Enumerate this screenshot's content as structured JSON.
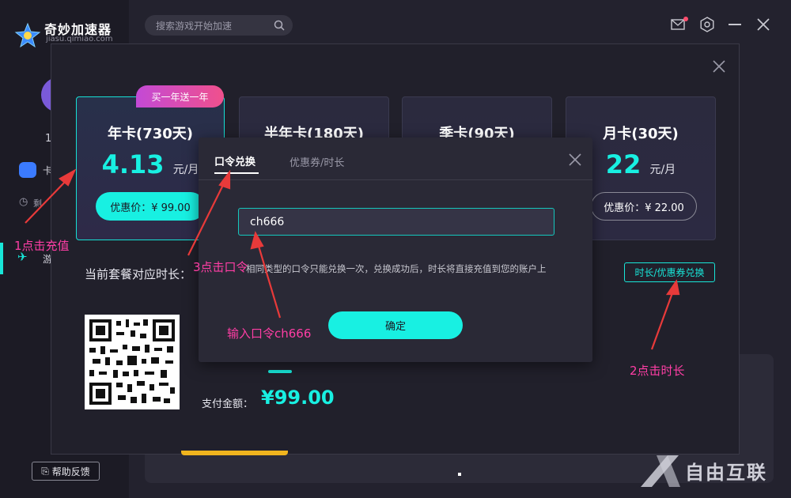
{
  "app": {
    "name": "奇妙加速器",
    "domain": "jiasu.qimiao.com"
  },
  "sidebar": {
    "user_fragment": "1",
    "card_fragment": "卡",
    "time_fragment": "剩",
    "game_fragment": "游",
    "help_label": "帮助反馈"
  },
  "topbar": {
    "search_placeholder": "搜索游戏开始加速"
  },
  "plans": [
    {
      "name": "年卡(730天)",
      "price": "4.13",
      "unit": "元/月",
      "button": "优惠价：¥ 99.00",
      "badge": "买一年送一年",
      "selected": true
    },
    {
      "name": "半年卡(180天)",
      "selected": false
    },
    {
      "name": "季卡(90天)",
      "selected": false
    },
    {
      "name": "月卡(30天)",
      "price": "22",
      "unit": "元/月",
      "button": "优惠价：¥ 22.00",
      "selected": false
    }
  ],
  "payment": {
    "duration_label": "当前套餐对应时长：",
    "redeem_button": "时长/优惠券兑换",
    "amount_label": "支付金额：",
    "amount": "¥99.00"
  },
  "code_dialog": {
    "tabs": [
      {
        "label": "口令兑换",
        "active": true
      },
      {
        "label": "优惠券/时长",
        "active": false
      }
    ],
    "input_value": "ch666",
    "note": "相同类型的口令只能兑换一次，兑换成功后，时长将直接充值到您的账户上",
    "confirm_label": "确定"
  },
  "annotations": [
    {
      "text": "1点击充值"
    },
    {
      "text": "2点击时长"
    },
    {
      "text": "3点击口令"
    },
    {
      "text": "输入口令ch666"
    }
  ],
  "colors": {
    "accent": "#18f0e2",
    "annotation": "#ff3ea5",
    "arrow": "#e83a3a",
    "badge_start": "#c34ad6",
    "badge_end": "#f0508c"
  },
  "watermark": "自由互联"
}
